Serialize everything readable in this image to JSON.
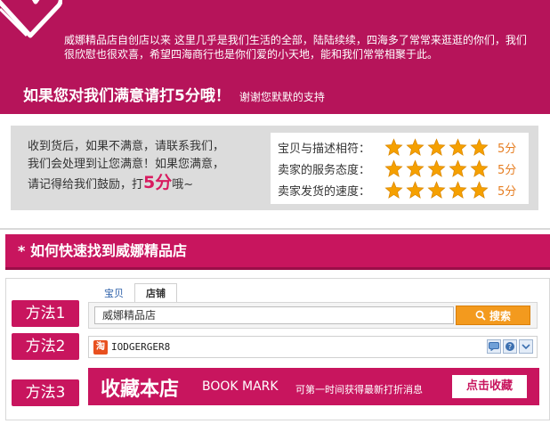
{
  "banner": {
    "intro": "威娜精品店自创店以来 这里几乎是我们生活的全部，陆陆续续，四海多了常常来逛逛的你们，我们很欣慰也很欢喜，希望四海商行也是你们爱的小天地，能和我们常常相聚于此。",
    "slogan": "如果您对我们满意请打5分哦！",
    "slogan_sub": "谢谢您默默的支持"
  },
  "rating": {
    "text_line1": "收到货后，如果不满意，请联系我们，",
    "text_line2": "我们会处理到让您满意！如果您满意，",
    "text_line3_prefix": "请记得给我们鼓励，打",
    "text_line3_highlight": "5分",
    "text_line3_suffix": "哦~",
    "rows": [
      {
        "label": "宝贝与描述相符：",
        "stars": 5,
        "score": "5分"
      },
      {
        "label": "卖家的服务态度：",
        "stars": 5,
        "score": "5分"
      },
      {
        "label": "卖家发货的速度：",
        "stars": 5,
        "score": "5分"
      }
    ],
    "star_color": "#f5a000"
  },
  "section": {
    "title": "* 如何快速找到威娜精品店"
  },
  "methods": {
    "method1": {
      "label": "方法1",
      "tabs": [
        "宝贝",
        "店铺"
      ],
      "active_tab": 1,
      "search_value": "威娜精品店",
      "search_button": "搜索"
    },
    "method2": {
      "label": "方法2",
      "icon_text": "淘",
      "wangwang_id": "IODGERGER8"
    },
    "method3": {
      "label": "方法3",
      "title_cn": "收藏本店",
      "title_en": "BOOK MARK",
      "desc": "可第一时间获得最新打折消息",
      "button": "点击收藏"
    }
  },
  "colors": {
    "brand": "#c8155e",
    "banner": "#b6145a",
    "search_button": "#f39a1e"
  }
}
